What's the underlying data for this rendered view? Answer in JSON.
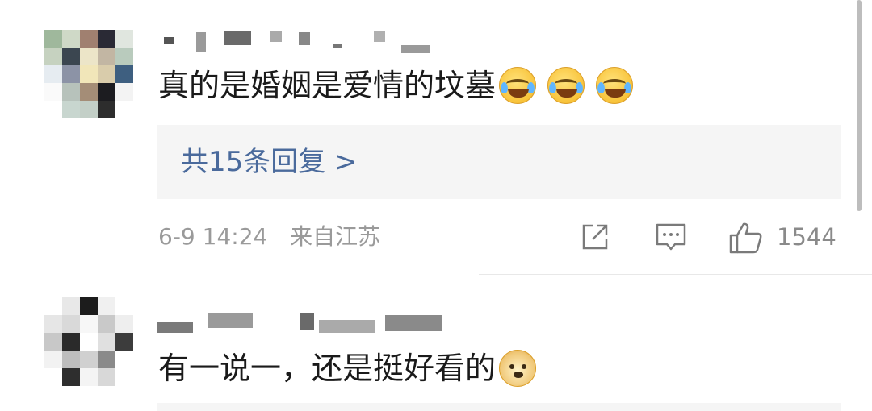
{
  "comments": [
    {
      "text": "真的是婚姻是爱情的坟墓",
      "emojis": [
        "laugh-cry-emoji",
        "laugh-cry-emoji",
        "laugh-cry-emoji"
      ],
      "replies_link": "共15条回复 >",
      "date": "6-9 14:24",
      "location": "来自江苏",
      "likes": "1544"
    },
    {
      "text": "有一说一，还是挺好看的",
      "emojis": [
        "doge-emoji"
      ]
    }
  ],
  "icons": {
    "share": "share-icon",
    "comment": "comment-icon",
    "like": "thumbs-up-icon"
  },
  "colors": {
    "link": "#4a6a9c",
    "meta": "#9a9a9a",
    "text": "#1a1a1a",
    "reply_bg": "#f5f5f5"
  }
}
